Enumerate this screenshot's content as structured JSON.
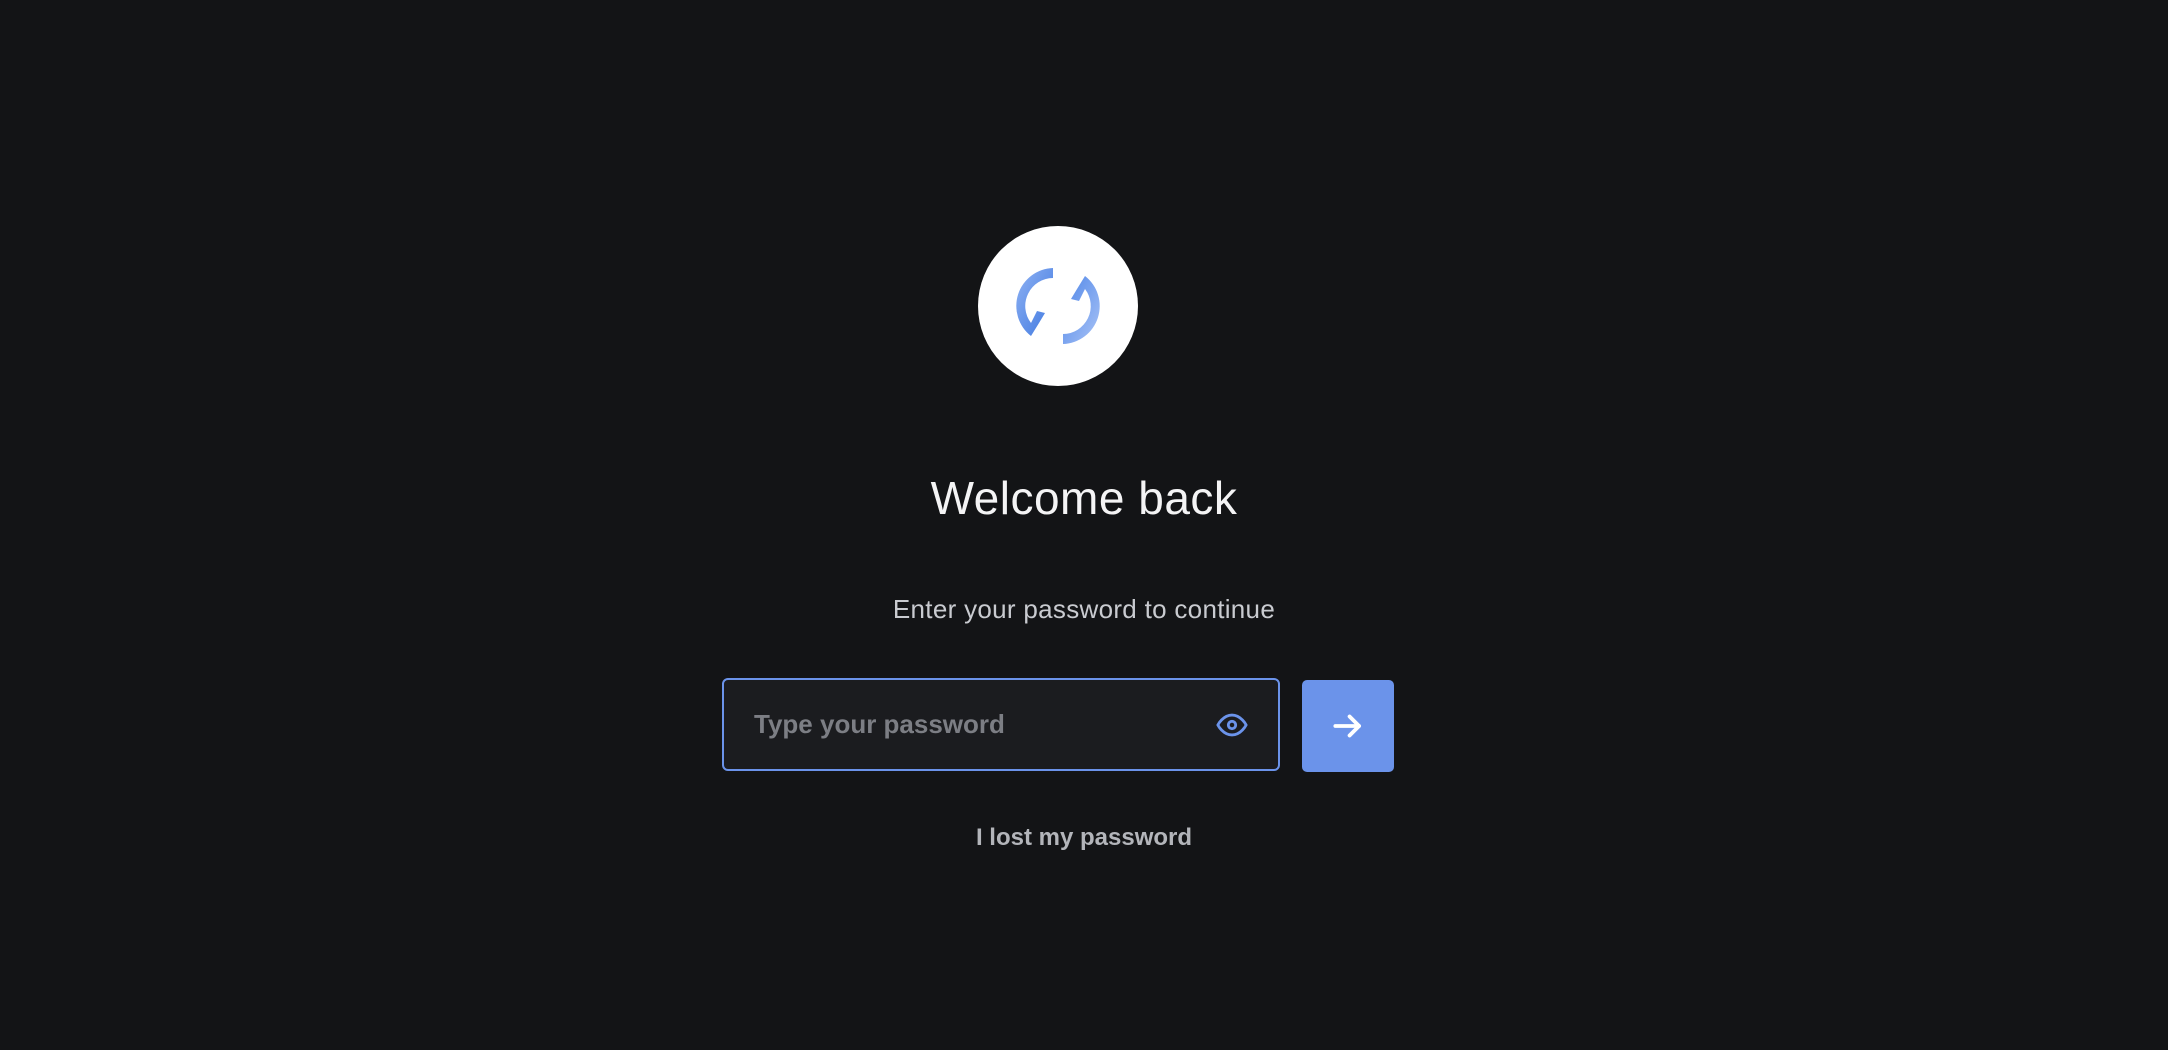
{
  "logo": {
    "icon": "sync-logo-icon",
    "colors": {
      "primary": "#4f86e8",
      "light": "#8fb2f3"
    }
  },
  "header": {
    "title": "Welcome back",
    "subtitle": "Enter your password to continue"
  },
  "form": {
    "password_placeholder": "Type your password",
    "password_value": "",
    "toggle_icon": "eye-icon",
    "submit_icon": "arrow-right-icon",
    "lost_password_label": "I lost my password"
  },
  "colors": {
    "background": "#131416",
    "accent": "#6b93ea",
    "field_background": "#1b1c1f"
  }
}
